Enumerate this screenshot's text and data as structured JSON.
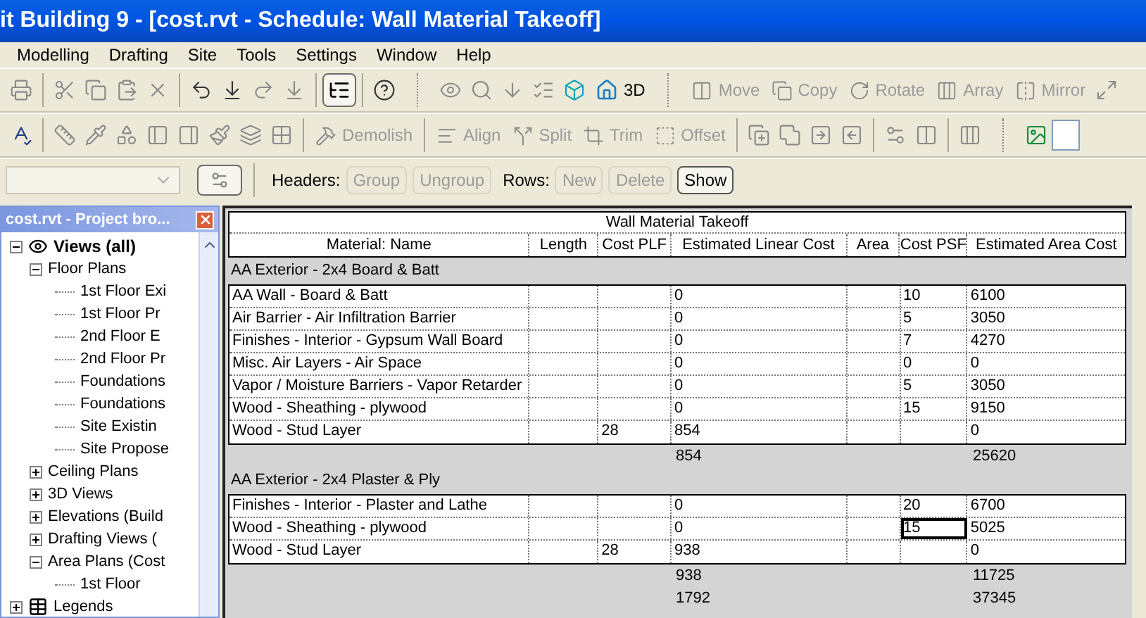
{
  "window": {
    "title": "it Building 9 - [cost.rvt - Schedule: Wall Material Takeoff]"
  },
  "menu": [
    "Modelling",
    "Drafting",
    "Site",
    "Tools",
    "Settings",
    "Window",
    "Help"
  ],
  "toolbar_1": {
    "browser_toggle": {
      "pressed": true
    },
    "view_3d": {
      "label": "3D"
    },
    "edit_tools": [
      {
        "label": "Move",
        "disabled": true
      },
      {
        "label": "Copy",
        "disabled": true
      },
      {
        "label": "Rotate",
        "disabled": true
      },
      {
        "label": "Array",
        "disabled": true
      },
      {
        "label": "Mirror",
        "disabled": true
      }
    ]
  },
  "toolbar_2": {
    "tools": [
      {
        "label": "Demolish",
        "disabled": true
      },
      {
        "label": "Align",
        "disabled": true
      },
      {
        "label": "Split",
        "disabled": true
      },
      {
        "label": "Trim",
        "disabled": true
      },
      {
        "label": "Offset",
        "disabled": true
      }
    ]
  },
  "toolbar_3": {
    "headers_label": "Headers:",
    "header_buttons": [
      {
        "label": "Group",
        "disabled": true
      },
      {
        "label": "Ungroup",
        "disabled": true
      }
    ],
    "rows_label": "Rows:",
    "row_buttons": [
      {
        "label": "New",
        "disabled": true
      },
      {
        "label": "Delete",
        "disabled": true
      },
      {
        "label": "Show",
        "disabled": false
      }
    ]
  },
  "project_browser": {
    "title": "cost.rvt - Project bro...",
    "tree": [
      {
        "label": "Views (all)",
        "kind": "views",
        "expanded": true,
        "children": [
          {
            "label": "Floor Plans",
            "kind": "folder",
            "expanded": true,
            "children": [
              {
                "label": "1st Floor Exi",
                "kind": "view"
              },
              {
                "label": "1st Floor Pr",
                "kind": "view"
              },
              {
                "label": "2nd Floor E",
                "kind": "view"
              },
              {
                "label": "2nd Floor Pr",
                "kind": "view"
              },
              {
                "label": "Foundations",
                "kind": "view"
              },
              {
                "label": "Foundations",
                "kind": "view"
              },
              {
                "label": "Site Existin",
                "kind": "view"
              },
              {
                "label": "Site Propose",
                "kind": "view"
              }
            ]
          },
          {
            "label": "Ceiling Plans",
            "kind": "folder",
            "expanded": false
          },
          {
            "label": "3D Views",
            "kind": "folder",
            "expanded": false
          },
          {
            "label": "Elevations (Build",
            "kind": "folder",
            "expanded": false
          },
          {
            "label": "Drafting Views (",
            "kind": "folder",
            "expanded": false
          },
          {
            "label": "Area Plans (Cost",
            "kind": "folder",
            "expanded": true,
            "children": [
              {
                "label": "1st Floor",
                "kind": "view"
              }
            ]
          }
        ]
      },
      {
        "label": "Legends",
        "kind": "legends",
        "expanded": false
      }
    ]
  },
  "schedule": {
    "title": "Wall Material Takeoff",
    "columns": [
      "Material: Name",
      "Length",
      "Cost PLF",
      "Estimated Linear Cost",
      "Area",
      "Cost PSF",
      "Estimated Area Cost"
    ],
    "groups": [
      {
        "header": "AA Exterior - 2x4 Board & Batt",
        "rows": [
          {
            "cells": [
              {
                "text": "AA Wall - Board & Batt",
                "selected": false
              },
              {
                "selected": false
              },
              {
                "selected": false
              },
              {
                "text": "0",
                "selected": false
              },
              {
                "selected": false
              },
              {
                "text": "10",
                "selected": false
              },
              {
                "text": "6100",
                "selected": false
              }
            ]
          },
          {
            "cells": [
              {
                "text": "Air Barrier - Air Infiltration Barrier",
                "selected": false
              },
              {
                "selected": false
              },
              {
                "selected": false
              },
              {
                "text": "0",
                "selected": false
              },
              {
                "selected": false
              },
              {
                "text": "5",
                "selected": false
              },
              {
                "text": "3050",
                "selected": false
              }
            ]
          },
          {
            "cells": [
              {
                "text": "Finishes - Interior - Gypsum Wall Board",
                "selected": false
              },
              {
                "selected": false
              },
              {
                "selected": false
              },
              {
                "text": "0",
                "selected": false
              },
              {
                "selected": false
              },
              {
                "text": "7",
                "selected": false
              },
              {
                "text": "4270",
                "selected": false
              }
            ]
          },
          {
            "cells": [
              {
                "text": "Misc. Air Layers - Air Space",
                "selected": false
              },
              {
                "selected": false
              },
              {
                "selected": false
              },
              {
                "text": "0",
                "selected": false
              },
              {
                "selected": false
              },
              {
                "text": "0",
                "selected": false
              },
              {
                "text": "0",
                "selected": false
              }
            ]
          },
          {
            "cells": [
              {
                "text": "Vapor / Moisture Barriers - Vapor Retarder",
                "selected": false
              },
              {
                "selected": false
              },
              {
                "selected": false
              },
              {
                "text": "0",
                "selected": false
              },
              {
                "selected": false
              },
              {
                "text": "5",
                "selected": false
              },
              {
                "text": "3050",
                "selected": false
              }
            ]
          },
          {
            "cells": [
              {
                "text": "Wood - Sheathing - plywood",
                "selected": false
              },
              {
                "selected": false
              },
              {
                "selected": false
              },
              {
                "text": "0",
                "selected": false
              },
              {
                "selected": false
              },
              {
                "text": "15",
                "selected": false
              },
              {
                "text": "9150",
                "selected": false
              }
            ]
          },
          {
            "cells": [
              {
                "text": "Wood - Stud Layer",
                "selected": false
              },
              {
                "selected": false
              },
              {
                "text": "28",
                "selected": false
              },
              {
                "text": "854",
                "selected": false
              },
              {
                "selected": false
              },
              {
                "selected": false
              },
              {
                "text": "0",
                "selected": false
              }
            ]
          }
        ],
        "subtotal": {
          "linear_cost": "854",
          "area_cost": "25620"
        }
      },
      {
        "header": "AA Exterior - 2x4 Plaster & Ply",
        "rows": [
          {
            "cells": [
              {
                "text": "Finishes - Interior - Plaster and Lathe",
                "selected": false
              },
              {
                "selected": false
              },
              {
                "selected": false
              },
              {
                "text": "0",
                "selected": false
              },
              {
                "selected": false
              },
              {
                "text": "20",
                "selected": false
              },
              {
                "text": "6700",
                "selected": false
              }
            ]
          },
          {
            "cells": [
              {
                "text": "Wood - Sheathing - plywood",
                "selected": false
              },
              {
                "selected": false
              },
              {
                "selected": false
              },
              {
                "text": "0",
                "selected": false
              },
              {
                "selected": false
              },
              {
                "text": "15",
                "selected": true
              },
              {
                "text": "5025",
                "selected": false
              }
            ]
          },
          {
            "cells": [
              {
                "text": "Wood - Stud Layer",
                "selected": false
              },
              {
                "selected": false
              },
              {
                "text": "28",
                "selected": false
              },
              {
                "text": "938",
                "selected": false
              },
              {
                "selected": false
              },
              {
                "selected": false
              },
              {
                "text": "0",
                "selected": false
              }
            ]
          }
        ],
        "subtotal": {
          "linear_cost": "938",
          "area_cost": "11725"
        }
      }
    ],
    "grand_total": {
      "linear_cost": "1792",
      "area_cost": "37345"
    }
  }
}
